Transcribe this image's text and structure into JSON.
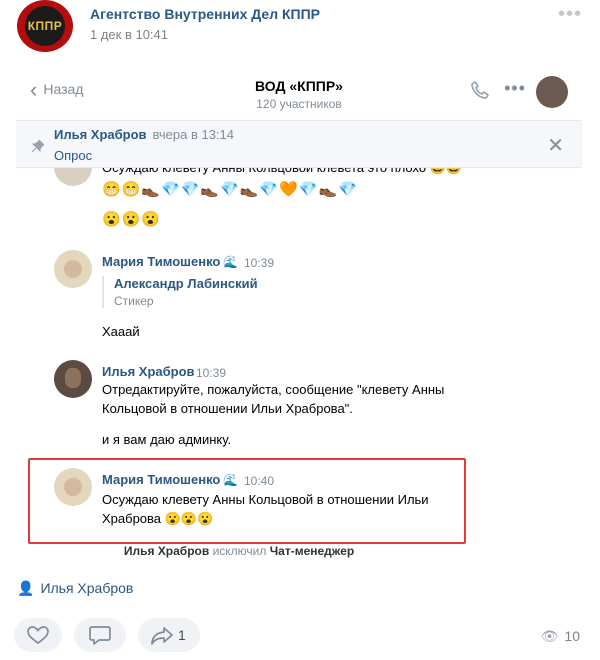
{
  "post": {
    "group_name": "Агентство Внутренних Дел КППР",
    "date": "1 дек в 10:41",
    "logo_text": "КППР",
    "more_icon": "more-dots-icon"
  },
  "chat": {
    "back_label": "Назад",
    "title": "ВОД «КППР»",
    "members": "120 участников",
    "pinned": {
      "author": "Илья Храбров",
      "time": "вчера в 13:14",
      "kind": "Опрос"
    },
    "cut_text": "Осуждаю клевету Анны Кольцовой клевета это плохо 😄😄",
    "emoji_row_1": "😁😁👞💎💎👞💎👞💎🧡💎👞💎",
    "emoji_row_2": "😮😮😮",
    "messages": [
      {
        "author": "Мария Тимошенко",
        "time": "10:39",
        "reply_author": "Александр Лабинский",
        "reply_text": "Стикер",
        "text": "Хааай"
      },
      {
        "author": "Илья Храбров",
        "time": "10:39",
        "text_line1": "Отредактируйте, пожалуйста, сообщение \"клевету Анны",
        "text_line2": "Кольцовой в отношении Ильи Храброва\".",
        "text_line3": "и я вам даю админку."
      },
      {
        "author": "Мария Тимошенко",
        "time": "10:40",
        "text_line1": "Осуждаю клевету Анны Кольцовой в отношении Ильи",
        "text_line2": "Храброва 😮😮😮"
      }
    ],
    "service": {
      "actor": "Илья Храбров",
      "action": "исключил",
      "target": "Чат-менеджер"
    }
  },
  "footer": {
    "signer": "Илья Храбров",
    "share_count": "1",
    "views": "10"
  },
  "colors": {
    "link": "#2a5885",
    "muted": "#818c99",
    "highlight": "#e03a3a"
  }
}
